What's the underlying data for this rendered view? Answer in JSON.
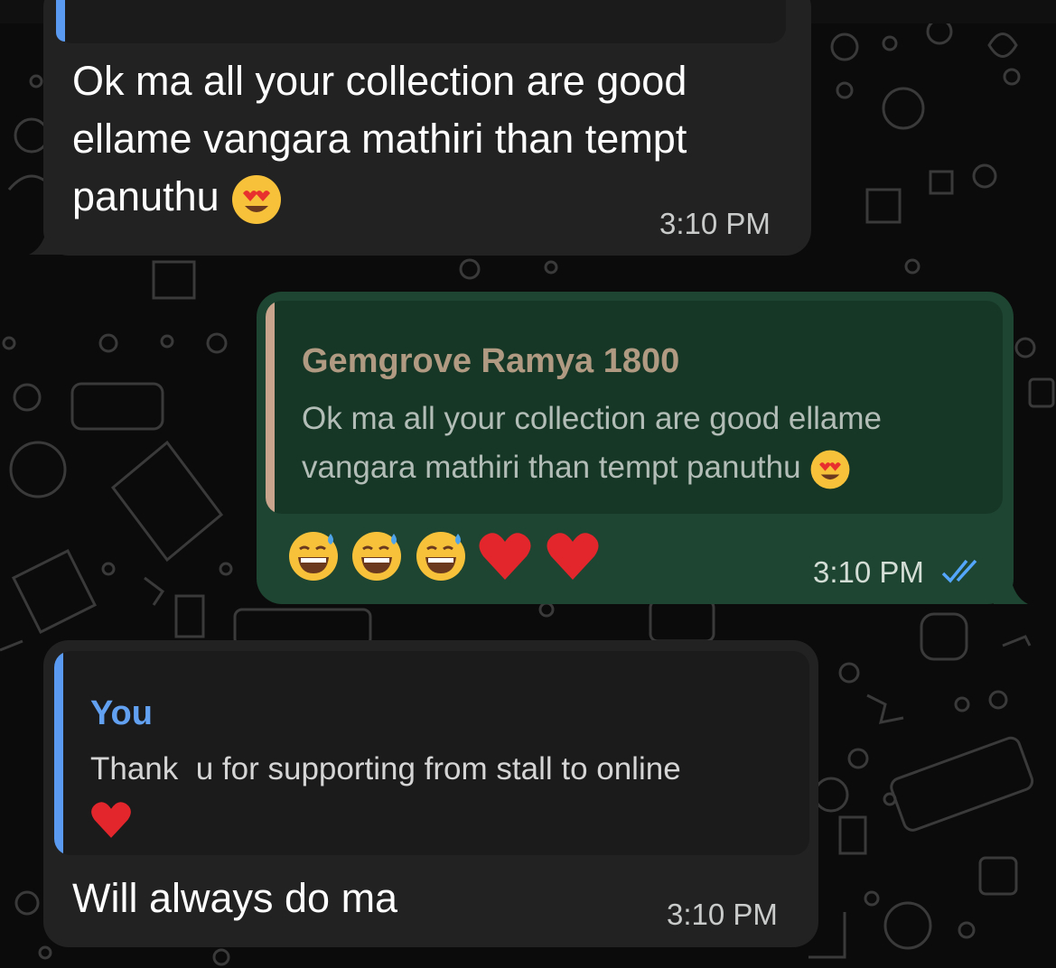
{
  "messages": [
    {
      "id": "m1",
      "direction": "incoming",
      "text_lines": [
        "Ok ma all your collection are good",
        "ellame vangara mathiri than tempt",
        "panuthu"
      ],
      "trailing_emoji": "smiling-face-with-heart-eyes",
      "time": "3:10 PM"
    },
    {
      "id": "m2",
      "direction": "outgoing",
      "reply_to": {
        "author": "Gemgrove Ramya 1800",
        "text_lines": [
          "Ok ma all your collection are good ellame",
          "vangara mathiri than tempt panuthu"
        ],
        "trailing_emoji": "smiling-face-with-heart-eyes"
      },
      "emojis": [
        "grinning-face-with-sweat",
        "grinning-face-with-sweat",
        "grinning-face-with-sweat",
        "red-heart",
        "red-heart"
      ],
      "time": "3:10 PM",
      "status": "read",
      "status_icon": "double-check-icon"
    },
    {
      "id": "m3",
      "direction": "incoming",
      "reply_to": {
        "author": "You",
        "text_lines": [
          "Thank  u for supporting from stall to online"
        ],
        "trailing_emoji": "red-heart"
      },
      "text": "Will always do ma",
      "time": "3:10 PM"
    }
  ],
  "colors": {
    "background": "#0b0b0b",
    "incoming_bubble": "#222222",
    "outgoing_bubble": "#1e4531",
    "outgoing_quote_bg": "#173726",
    "incoming_quote_bg": "#1b1b1b",
    "quote_author_other": "#b09a82",
    "quote_bar_other": "#c9a58e",
    "quote_author_you": "#62a1f2",
    "quote_bar_you": "#5a9af0",
    "read_ticks": "#53a6fb"
  }
}
